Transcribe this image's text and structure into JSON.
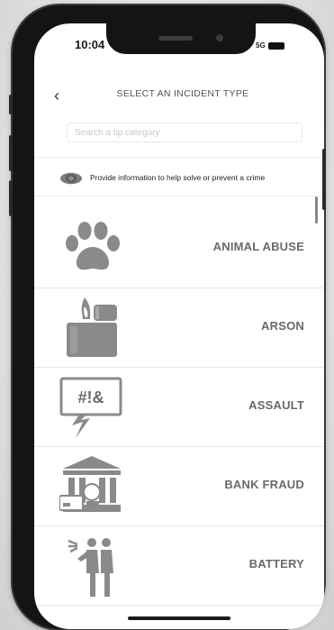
{
  "status_bar": {
    "time": "10:04",
    "network": "5G"
  },
  "header": {
    "back_icon": "chevron-left-icon",
    "back_glyph": "‹",
    "title": "SELECT AN INCIDENT TYPE"
  },
  "search": {
    "placeholder": "Search a tip category"
  },
  "info": {
    "icon": "eye-icon",
    "text": "Provide information to help solve or prevent a crime"
  },
  "incident_types": [
    {
      "label": "ANIMAL ABUSE",
      "icon": "paw-icon"
    },
    {
      "label": "ARSON",
      "icon": "lighter-flame-icon"
    },
    {
      "label": "ASSAULT",
      "icon": "speech-bubble-lightning-icon",
      "icon_text": "#!&"
    },
    {
      "label": "BANK FRAUD",
      "icon": "bank-building-icon"
    },
    {
      "label": "BATTERY",
      "icon": "people-fighting-icon"
    }
  ],
  "colors": {
    "icon_gray": "#8a8a8a",
    "label_gray": "#6a6a6a",
    "eye_fill": "#8a8a8a"
  }
}
